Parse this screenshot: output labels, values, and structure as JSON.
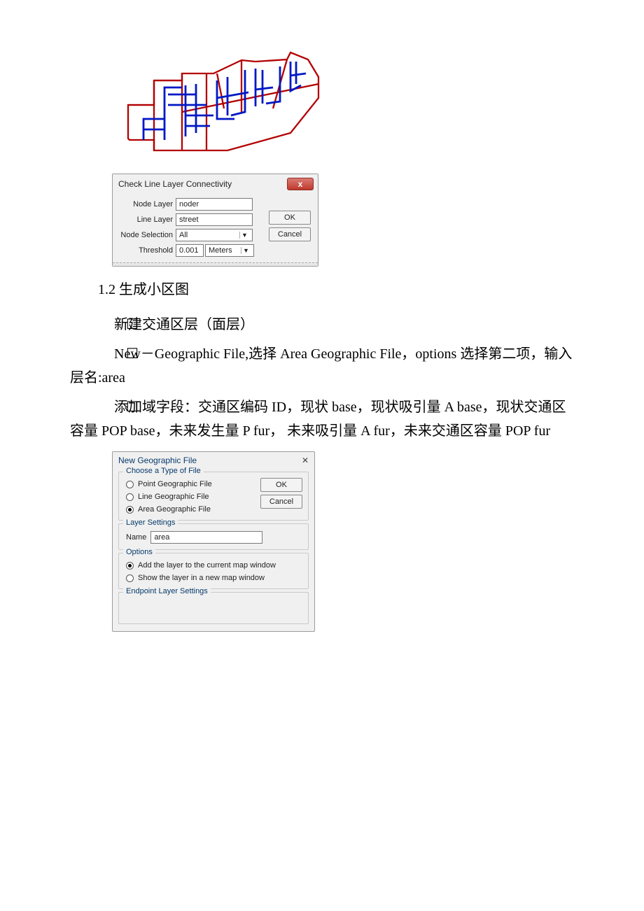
{
  "dialog1": {
    "title": "Check Line Layer Connectivity",
    "close_symbol": "x",
    "node_layer_label": "Node Layer",
    "node_layer_value": "noder",
    "line_layer_label": "Line Layer",
    "line_layer_value": "street",
    "node_selection_label": "Node Selection",
    "node_selection_value": "All",
    "threshold_label": "Threshold",
    "threshold_value": "0.001",
    "threshold_unit": "Meters",
    "ok_label": "OK",
    "cancel_label": "Cancel"
  },
  "text": {
    "section_heading": "1.2 生成小区图",
    "line2": " 新建交通区层（面层）",
    "line3": " New－Geographic File,选择 Area Geographic File，options 选择第二项，输入层名:area",
    "line4": " 添加域字段：交通区编码 ID，现状 base，现状吸引量 A base，现状交通区容量 POP base，未来发生量 P fur， 未来吸引量 A fur，未来交通区容量 POP fur"
  },
  "dialog2": {
    "title": "New Geographic File",
    "close_symbol": "✕",
    "group1_legend": "Choose a Type of File",
    "radio1": "Point Geographic File",
    "radio2": "Line Geographic File",
    "radio3": "Area Geographic File",
    "ok_label": "OK",
    "cancel_label": "Cancel",
    "group2_legend": "Layer Settings",
    "name_label": "Name",
    "name_value": "area",
    "group3_legend": "Options",
    "option1": "Add the layer to the current map window",
    "option2": "Show the layer in a new map window",
    "group4_legend": "Endpoint Layer Settings"
  },
  "checkbox_glyph": "☐"
}
